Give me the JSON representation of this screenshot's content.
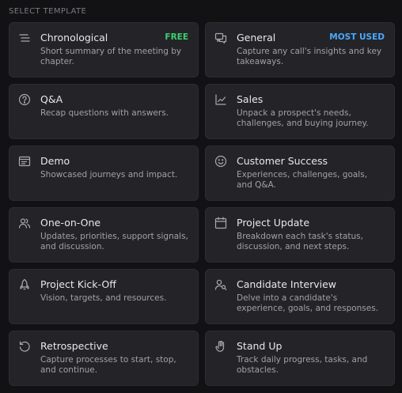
{
  "heading": "SELECT TEMPLATE",
  "colors": {
    "free_badge": "#3ccf6e",
    "most_used_badge": "#4aa8ff"
  },
  "templates": [
    {
      "title": "Chronological",
      "description": "Short summary of the meeting by chapter.",
      "icon": "list-lines-icon",
      "badge": "FREE"
    },
    {
      "title": "General",
      "description": "Capture any call's insights and key takeaways.",
      "icon": "chat-bubbles-icon",
      "badge": "MOST USED"
    },
    {
      "title": "Q&A",
      "description": "Recap questions with answers.",
      "icon": "question-circle-icon"
    },
    {
      "title": "Sales",
      "description": "Unpack a prospect's needs, challenges, and buying journey.",
      "icon": "line-chart-icon"
    },
    {
      "title": "Demo",
      "description": "Showcased journeys and impact.",
      "icon": "browser-window-icon"
    },
    {
      "title": "Customer Success",
      "description": "Experiences, challenges, goals, and Q&A.",
      "icon": "smiley-icon"
    },
    {
      "title": "One-on-One",
      "description": "Updates, priorities, support signals, and discussion.",
      "icon": "two-people-icon"
    },
    {
      "title": "Project Update",
      "description": "Breakdown each task's status, discussion, and next steps.",
      "icon": "calendar-icon"
    },
    {
      "title": "Project Kick-Off",
      "description": "Vision, targets, and resources.",
      "icon": "rocket-icon"
    },
    {
      "title": "Candidate Interview",
      "description": "Delve into a candidate's experience, goals, and responses.",
      "icon": "person-search-icon"
    },
    {
      "title": "Retrospective",
      "description": "Capture processes to start, stop, and continue.",
      "icon": "rotate-ccw-icon"
    },
    {
      "title": "Stand Up",
      "description": "Track daily progress, tasks, and obstacles.",
      "icon": "hand-icon"
    }
  ]
}
